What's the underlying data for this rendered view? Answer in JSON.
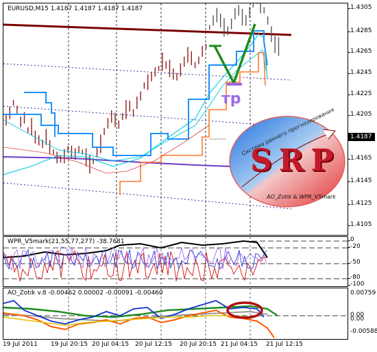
{
  "chart": {
    "symbol_label": "EURUSD,M15  1.4187 1.4187 1.4187 1.4187",
    "last_price": "1.4187",
    "price_scale": [
      "1.4305",
      "1.4285",
      "1.4265",
      "1.4245",
      "1.4225",
      "1.4205",
      "1.4165",
      "1.4145",
      "1.4125",
      "1.4105"
    ],
    "time_labels": [
      "19 Jul 2011",
      "19 Jul 20:15",
      "20 Jul 04:15",
      "20 Jul 12:15",
      "20 Jul 20:15",
      "21 Jul 04:15",
      "21 Jul 12:15"
    ],
    "annotation_tp": "тр"
  },
  "wpr": {
    "label": "WPR_V5mark(21,55,77,277) -38.7681",
    "scale": [
      "0",
      "-20",
      "-50",
      "-80",
      "-100"
    ]
  },
  "ao": {
    "label": "AO_Zotik v.8  -0.00462 0.00002 -0.00091 -0.00460",
    "scale": [
      "0.00759",
      "0.00",
      "0.00",
      "-0.00588"
    ]
  },
  "logo": {
    "letters": "SRP",
    "arc_text": "Система раннего прогнозирования",
    "credit": "AO_Zotik & WPR_V5mark"
  },
  "colors": {
    "candles": "#8b1a1a",
    "trend_line": "#7a0000",
    "ma_blue": "#1e90ff",
    "ma_cyan": "#00c8e0",
    "stop_orange": "#ff7a2a",
    "purple": "#6a3cc8",
    "green_marker": "#1e8c1e"
  }
}
